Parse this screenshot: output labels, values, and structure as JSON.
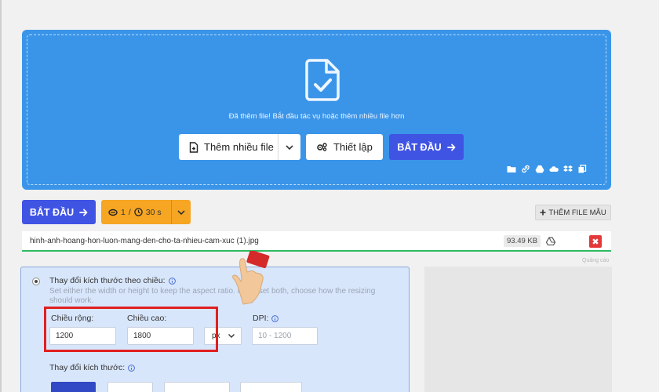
{
  "dropzone": {
    "message": "Đã thêm file! Bắt đầu tác vụ hoặc thêm nhiều file hơn",
    "add_more_label": "Thêm nhiều file",
    "settings_label": "Thiết lập",
    "start_label": "BẮT ĐẦU",
    "color": "#3a95e9"
  },
  "toolbar": {
    "start_label": "BẮT ĐẦU",
    "counter_files": "1",
    "counter_separator": "/",
    "counter_time": "30 s",
    "add_sample_label": "THÊM FILE MẪU"
  },
  "file": {
    "name": "hinh-anh-hoang-hon-luon-mang-den-cho-ta-nhieu-cam-xuc (1).jpg",
    "size": "93.49 KB",
    "delete_symbol": "✖"
  },
  "ad_label": "Quảng cáo",
  "resize_options": {
    "by_dimension_title": "Thay đổi kích thước theo chiều:",
    "by_dimension_desc": "Set either the width or height to keep the aspect ratio. If you set both, choose how the resizing should work.",
    "width_label": "Chiều rộng:",
    "width_value": "1200",
    "height_label": "Chiều cao:",
    "height_value": "1800",
    "unit": "px",
    "dpi_label": "DPI:",
    "dpi_placeholder": "10 - 1200",
    "size_title": "Thay đổi kích thước:"
  },
  "colors": {
    "primary": "#4054e4",
    "accent_orange": "#f6a623",
    "success": "#2fbc61",
    "danger": "#e53939",
    "highlight": "#e02020"
  }
}
